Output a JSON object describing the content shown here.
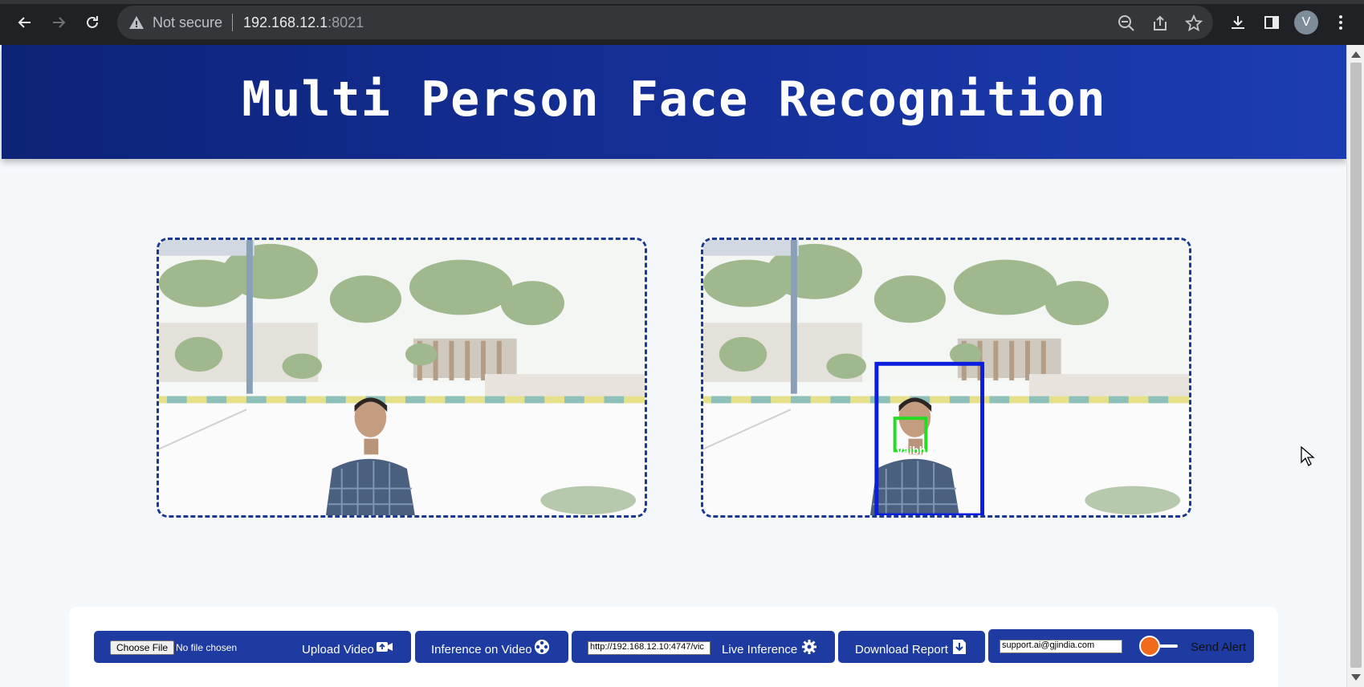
{
  "browser": {
    "security_label": "Not secure",
    "url_host": "192.168.12.1",
    "url_port": ":8021",
    "avatar_initial": "V",
    "icons": [
      "back-icon",
      "forward-icon",
      "reload-icon",
      "warning-icon",
      "zoom-out-icon",
      "share-icon",
      "star-icon",
      "download-icon",
      "side-panel-icon",
      "menu-icon"
    ]
  },
  "page": {
    "title": "Multi Person Face Recognition",
    "header_color": "#15309a"
  },
  "panes": {
    "right_detection_label": "Vaibh"
  },
  "toolbar": {
    "choose_file_label": "Choose File",
    "no_file_label": "No file chosen",
    "upload_label": "Upload Video",
    "inference_video_label": "Inference on Video",
    "stream_url_value": "http://192.168.12.10:4747/vic",
    "live_inference_label": "Live Inference",
    "download_label": "Download Report",
    "email_value": "support.ai@gjindia.com",
    "send_alert_label": "Send Alert",
    "button_color": "#1d3ba0",
    "toggle_color": "#f26b1d"
  }
}
